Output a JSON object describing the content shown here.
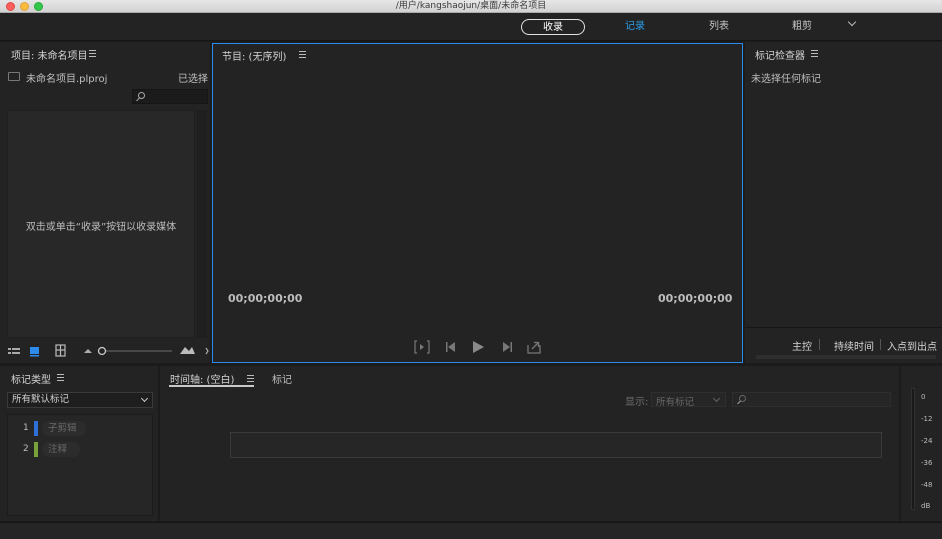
{
  "window": {
    "title": "/用户/kangshaojun/桌面/未命名项目"
  },
  "workspaces": {
    "items": [
      {
        "label": "收录"
      },
      {
        "label": "记录"
      },
      {
        "label": "列表"
      },
      {
        "label": "粗剪"
      }
    ],
    "active": "记录"
  },
  "project": {
    "title": "项目: 未命名项目",
    "file": "未命名项目.plproj",
    "selected_label": "已选择",
    "empty_hint": "双击或单击“收录”按钮以收录媒体"
  },
  "program": {
    "title": "节目: (无序列)",
    "timecode_left": "00;00;00;00",
    "timecode_right": "00;00;00;00"
  },
  "inspector": {
    "title": "标记检查器",
    "empty": "未选择任何标记",
    "cols": [
      "主控",
      "持续时间",
      "入点到出点"
    ]
  },
  "marker_types": {
    "title": "标记类型",
    "dropdown": "所有默认标记",
    "items": [
      {
        "num": "1",
        "name": "子剪辑",
        "color": "#2f6fd8"
      },
      {
        "num": "2",
        "name": "注释",
        "color": "#7aa23a"
      }
    ]
  },
  "timeline": {
    "tabs": [
      "时间轴: (空白)",
      "标记"
    ],
    "show_label": "显示:",
    "show_value": "所有标记"
  },
  "meter": {
    "labels": [
      "0",
      "-12",
      "-24",
      "-36",
      "-48",
      "dB"
    ]
  }
}
